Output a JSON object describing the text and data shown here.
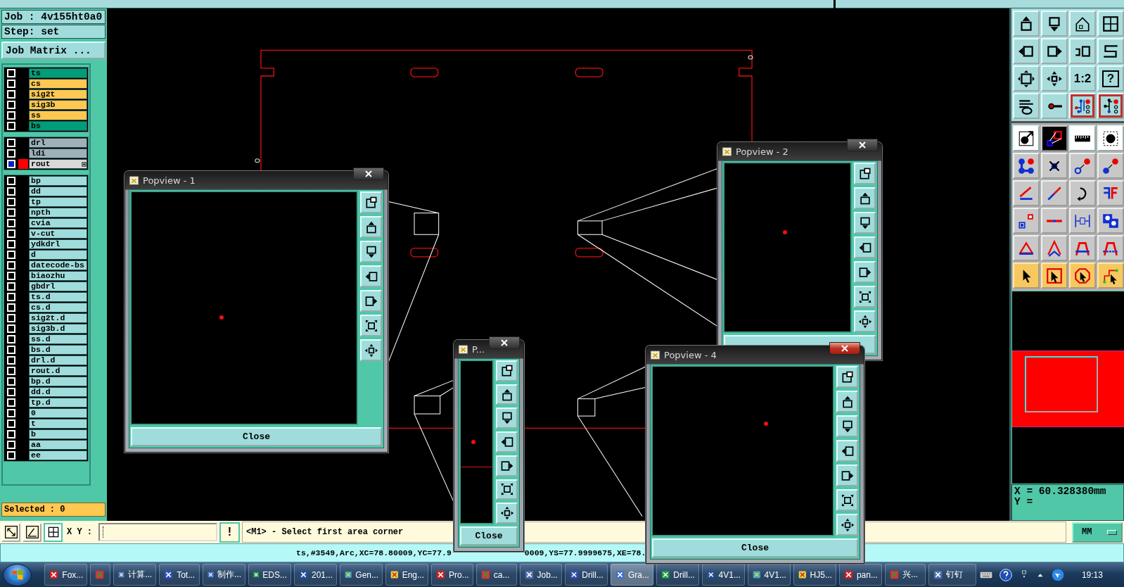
{
  "job": {
    "job_label": "Job : 4v155ht0a0",
    "step_label": "Step: set",
    "matrix_button": "Job Matrix ..."
  },
  "layer_groups": [
    {
      "layers": [
        {
          "name": "ts",
          "color": "#009e78",
          "affected": false,
          "work": false
        },
        {
          "name": "cs",
          "color": "#ffc850",
          "affected": false,
          "work": false
        },
        {
          "name": "sig2t",
          "color": "#ffc850",
          "affected": false,
          "work": false
        },
        {
          "name": "sig3b",
          "color": "#ffc850",
          "affected": false,
          "work": false
        },
        {
          "name": "ss",
          "color": "#ffc850",
          "affected": false,
          "work": false
        },
        {
          "name": "bs",
          "color": "#009e78",
          "affected": false,
          "work": false
        }
      ]
    },
    {
      "layers": [
        {
          "name": "drl",
          "color": "#a0b0b8",
          "affected": false,
          "work": false
        },
        {
          "name": "ldi",
          "color": "#a0b0b8",
          "affected": false,
          "work": false
        },
        {
          "name": "rout",
          "color": "#d8d8d8",
          "affected": true,
          "work": true
        }
      ]
    },
    {
      "layers": [
        {
          "name": "bp",
          "color": "#a0dcdc",
          "affected": false,
          "work": false
        },
        {
          "name": "dd",
          "color": "#a0dcdc",
          "affected": false,
          "work": false
        },
        {
          "name": "tp",
          "color": "#a0dcdc",
          "affected": false,
          "work": false
        },
        {
          "name": "npth",
          "color": "#a0dcdc",
          "affected": false,
          "work": false
        },
        {
          "name": "cvia",
          "color": "#a0dcdc",
          "affected": false,
          "work": false
        },
        {
          "name": "v-cut",
          "color": "#a0dcdc",
          "affected": false,
          "work": false
        },
        {
          "name": "ydkdrl",
          "color": "#a0dcdc",
          "affected": false,
          "work": false
        },
        {
          "name": "d",
          "color": "#a0dcdc",
          "affected": false,
          "work": false
        },
        {
          "name": "datecode-bs",
          "color": "#a0dcdc",
          "affected": false,
          "work": false
        },
        {
          "name": "biaozhu",
          "color": "#a0dcdc",
          "affected": false,
          "work": false
        },
        {
          "name": "gbdrl",
          "color": "#a0dcdc",
          "affected": false,
          "work": false
        },
        {
          "name": "ts.d",
          "color": "#a0dcdc",
          "affected": false,
          "work": false
        },
        {
          "name": "cs.d",
          "color": "#a0dcdc",
          "affected": false,
          "work": false
        },
        {
          "name": "sig2t.d",
          "color": "#a0dcdc",
          "affected": false,
          "work": false
        },
        {
          "name": "sig3b.d",
          "color": "#a0dcdc",
          "affected": false,
          "work": false
        },
        {
          "name": "ss.d",
          "color": "#a0dcdc",
          "affected": false,
          "work": false
        },
        {
          "name": "bs.d",
          "color": "#a0dcdc",
          "affected": false,
          "work": false
        },
        {
          "name": "drl.d",
          "color": "#a0dcdc",
          "affected": false,
          "work": false
        },
        {
          "name": "rout.d",
          "color": "#a0dcdc",
          "affected": false,
          "work": false
        },
        {
          "name": "bp.d",
          "color": "#a0dcdc",
          "affected": false,
          "work": false
        },
        {
          "name": "dd.d",
          "color": "#a0dcdc",
          "affected": false,
          "work": false
        },
        {
          "name": "tp.d",
          "color": "#a0dcdc",
          "affected": false,
          "work": false
        },
        {
          "name": "0",
          "color": "#a0dcdc",
          "affected": false,
          "work": false
        },
        {
          "name": "t",
          "color": "#a0dcdc",
          "affected": false,
          "work": false
        },
        {
          "name": "b",
          "color": "#a0dcdc",
          "affected": false,
          "work": false
        },
        {
          "name": "aa",
          "color": "#a0dcdc",
          "affected": false,
          "work": false
        },
        {
          "name": "ee",
          "color": "#a0dcdc",
          "affected": false,
          "work": false
        }
      ]
    }
  ],
  "selected_count": "Selected : 0",
  "toolbar_texts": [
    "1:2",
    "?"
  ],
  "coordinates": {
    "x": "X = 60.328380mm",
    "y": "Y ="
  },
  "command_bar": {
    "xy_label": "X Y :",
    "confirm_label": "!",
    "message": "<M1> - Select first area corner",
    "units": "MM"
  },
  "status_bar": {
    "text_left": "ts,#3549,Arc,XC=78.80009,YC=77.9",
    "text_right": "0009,YS=77.9999675,XE=78."
  },
  "popviews": [
    {
      "title": "Popview - 1",
      "close_label": "Close",
      "active": false
    },
    {
      "title": "Popview - 2",
      "active": false
    },
    {
      "title": "P...",
      "close_label": "Close",
      "active": false
    },
    {
      "title": "Popview - 4",
      "close_label": "Close",
      "active": true
    }
  ],
  "taskbar": {
    "items": [
      {
        "label": "Fox...",
        "selected": false
      },
      {
        "selected": false
      },
      {
        "label": "计算...",
        "selected": false
      },
      {
        "label": "Tot...",
        "selected": false
      },
      {
        "label": "制作...",
        "selected": false
      },
      {
        "label": "EDS...",
        "selected": false
      },
      {
        "label": "201...",
        "selected": false
      },
      {
        "label": "Gen...",
        "selected": false
      },
      {
        "label": "Eng...",
        "selected": false
      },
      {
        "label": "Pro...",
        "selected": false
      },
      {
        "label": "ca...",
        "selected": false
      },
      {
        "label": "Job...",
        "selected": false
      },
      {
        "label": "Drill...",
        "selected": false
      },
      {
        "label": "Gra...",
        "selected": true
      },
      {
        "label": "Drill...",
        "selected": false
      },
      {
        "label": "4V1...",
        "selected": false
      },
      {
        "label": "4V1...",
        "selected": false
      },
      {
        "label": "HJ5...",
        "selected": false
      },
      {
        "label": "pan...",
        "selected": false
      },
      {
        "label": "兴...",
        "selected": false
      },
      {
        "label": "钉钉",
        "selected": false
      }
    ],
    "clock": "19:13"
  }
}
